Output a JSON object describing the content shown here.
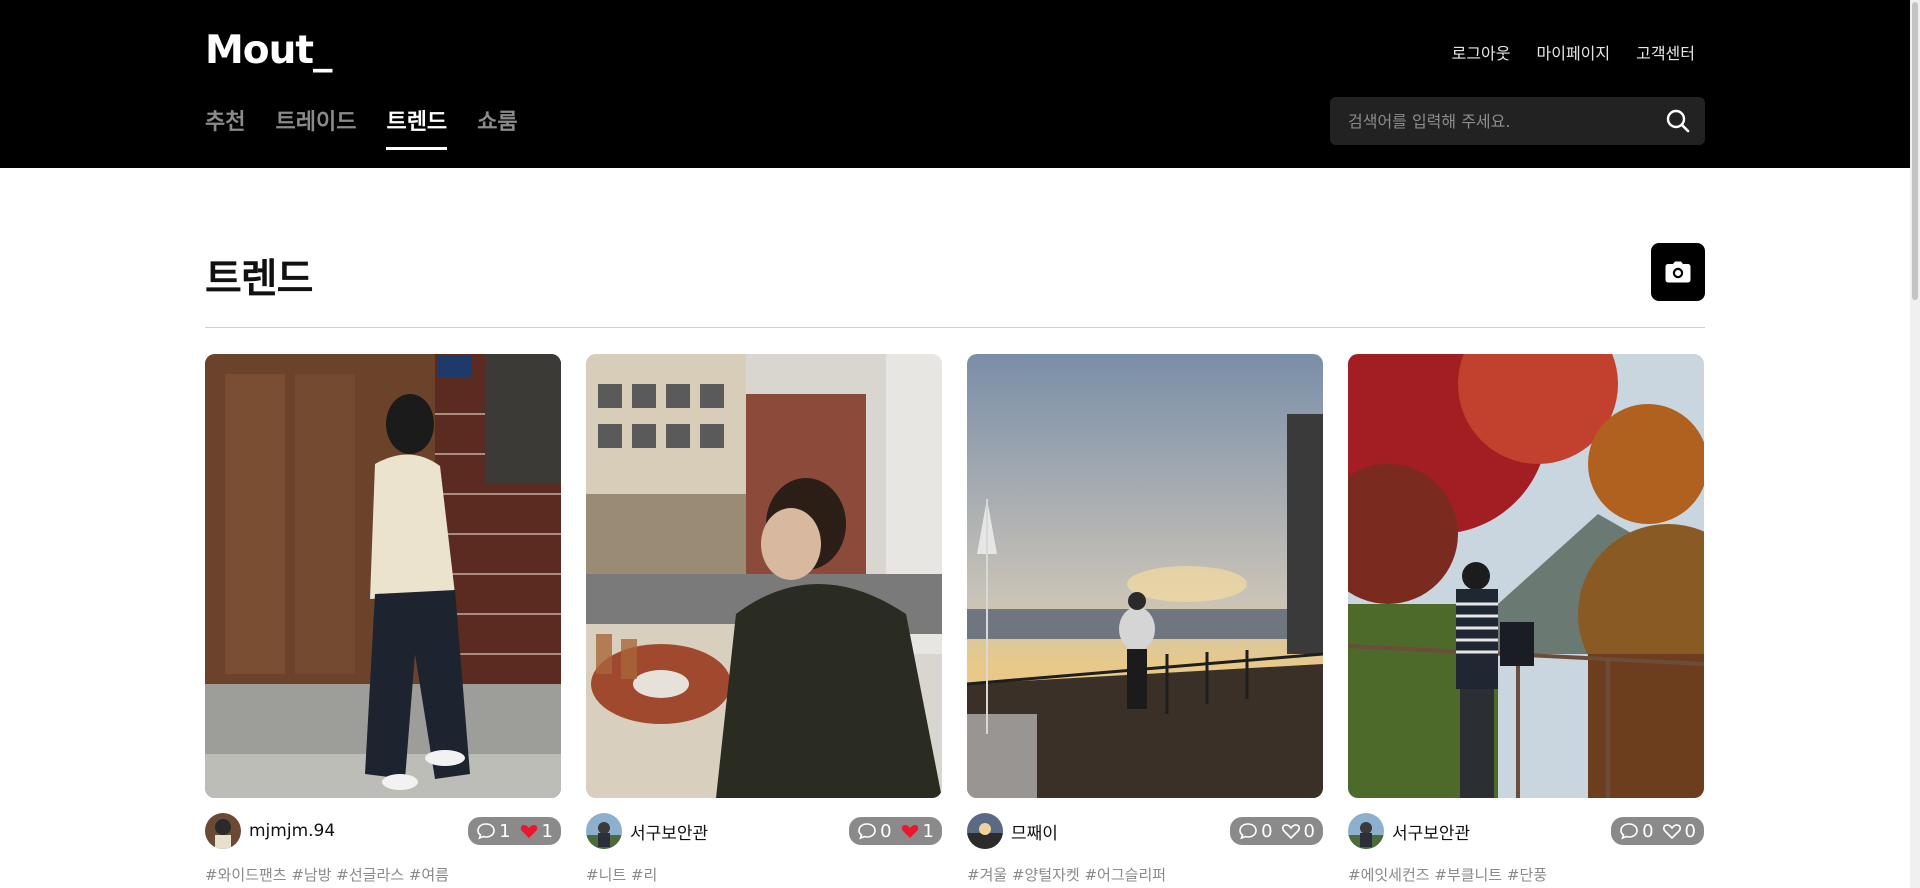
{
  "header": {
    "logo": "Mout_",
    "util_links": [
      "로그아웃",
      "마이페이지",
      "고객센터"
    ],
    "nav": [
      "추천",
      "트레이드",
      "트렌드",
      "쇼룸"
    ],
    "active_nav": "트렌드",
    "search_placeholder": "검색어를 입력해 주세요."
  },
  "page": {
    "title": "트렌드",
    "camera_icon": "camera-icon"
  },
  "posts": [
    {
      "username": "mjmjm.94",
      "comments": "1",
      "likes": "1",
      "liked": true,
      "tags": "#와이드팬츠 #남방 #선글라스 #여름"
    },
    {
      "username": "서구보안관",
      "comments": "0",
      "likes": "1",
      "liked": true,
      "tags": "#니트 #리"
    },
    {
      "username": "므째이",
      "comments": "0",
      "likes": "0",
      "liked": false,
      "tags": "#겨울 #양털자켓 #어그슬리퍼"
    },
    {
      "username": "서구보안관",
      "comments": "0",
      "likes": "0",
      "liked": false,
      "tags": "#에잇세컨즈 #부클니트 #단풍"
    }
  ],
  "colors": {
    "header_bg": "#000000",
    "like_active": "#e8182e",
    "stats_bg": "#8a8a8a"
  }
}
